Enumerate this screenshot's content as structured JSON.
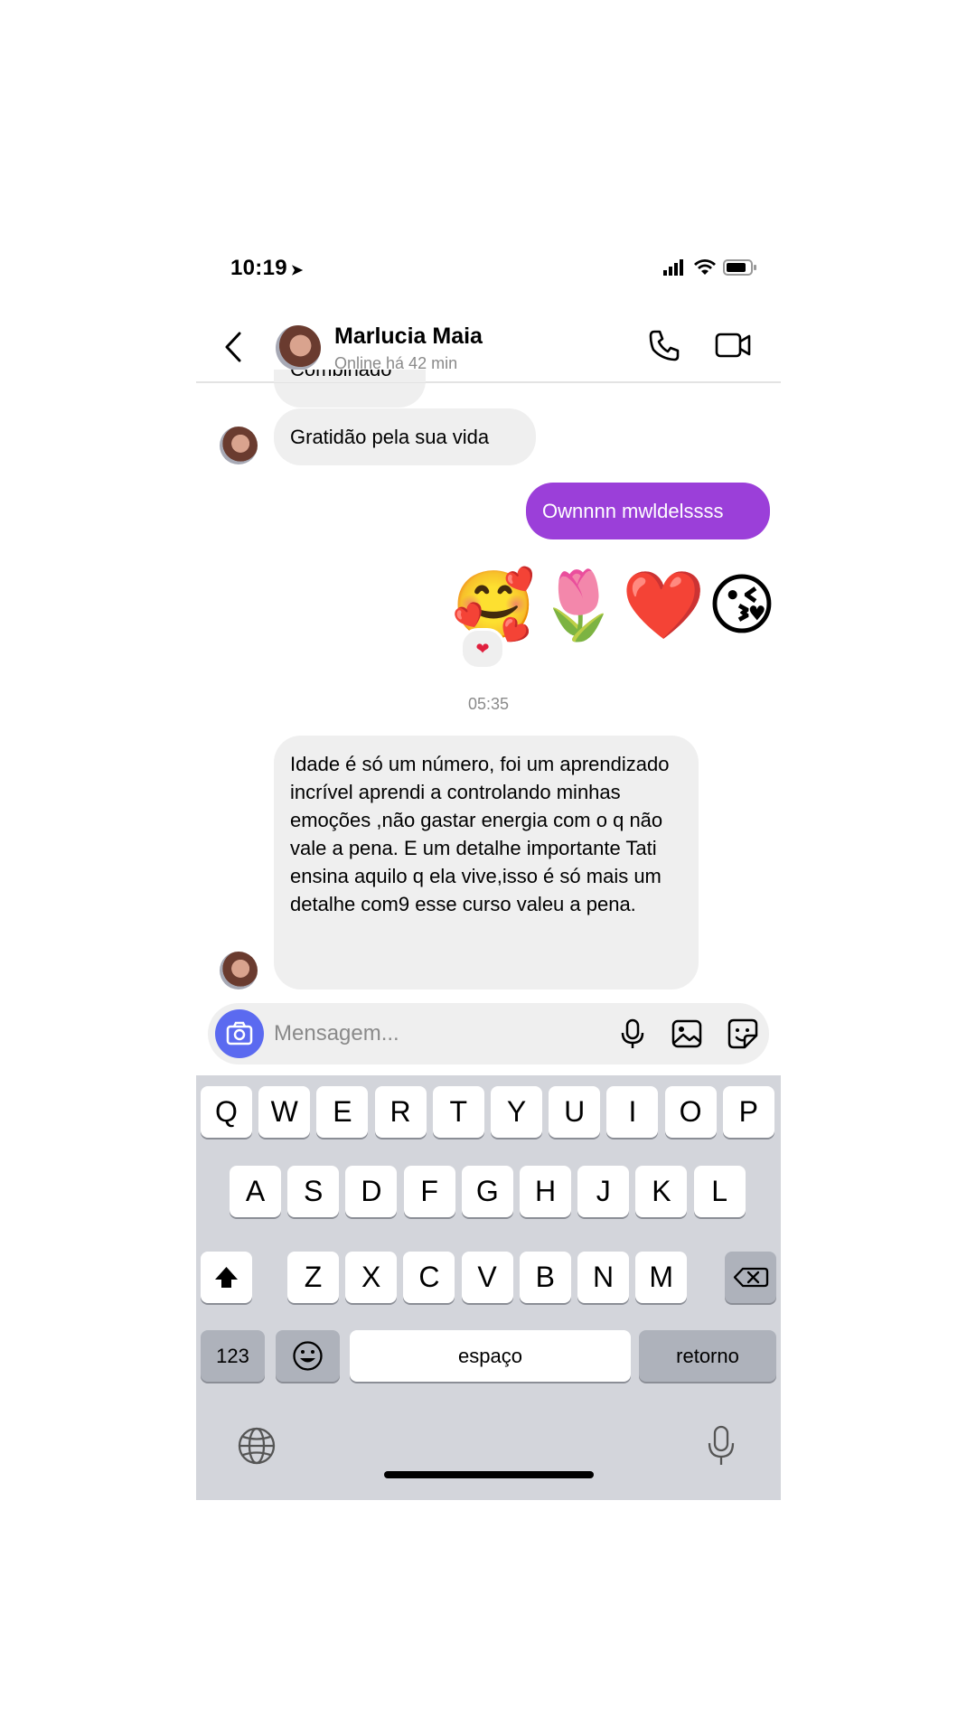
{
  "status_bar": {
    "time": "10:19",
    "location_arrow": "➤"
  },
  "header": {
    "contact_name": "Marlucia Maia",
    "status": "Online há 42 min",
    "icons": [
      "back-chevron-icon",
      "phone-icon",
      "video-icon"
    ]
  },
  "messages": {
    "partial_prev": "Combinado",
    "gratitude": "Gratidão pela sua vida",
    "outgoing": "Ownnnn mwldelssss",
    "emojis": "🥰🌷❤️😘",
    "reaction": "❤",
    "timestamp": "05:35",
    "long_text": "Idade é só um número, foi um aprendizado incrível aprendi a controlando minhas emoções ,não gastar energia com o q não vale a pena. E um detalhe importante Tati ensina aquilo q ela vive,isso é só mais um detalhe com9 esse curso valeu a pena."
  },
  "composer": {
    "placeholder": "Mensagem...",
    "icons": [
      "camera-icon",
      "microphone-icon",
      "gallery-icon",
      "sticker-icon"
    ]
  },
  "keyboard": {
    "row1": [
      "Q",
      "W",
      "E",
      "R",
      "T",
      "Y",
      "U",
      "I",
      "O",
      "P"
    ],
    "row2": [
      "A",
      "S",
      "D",
      "F",
      "G",
      "H",
      "J",
      "K",
      "L"
    ],
    "row3": [
      "Z",
      "X",
      "C",
      "V",
      "B",
      "N",
      "M"
    ],
    "numbers_key": "123",
    "space_key": "espaço",
    "return_key": "retorno",
    "icons": [
      "shift-icon",
      "backspace-icon",
      "emoji-icon",
      "globe-icon",
      "dictation-mic-icon"
    ]
  },
  "colors": {
    "outgoing_bubble": "#9b3fd9",
    "camera_button": "#5b6af0",
    "keyboard_bg": "#d3d5db"
  }
}
